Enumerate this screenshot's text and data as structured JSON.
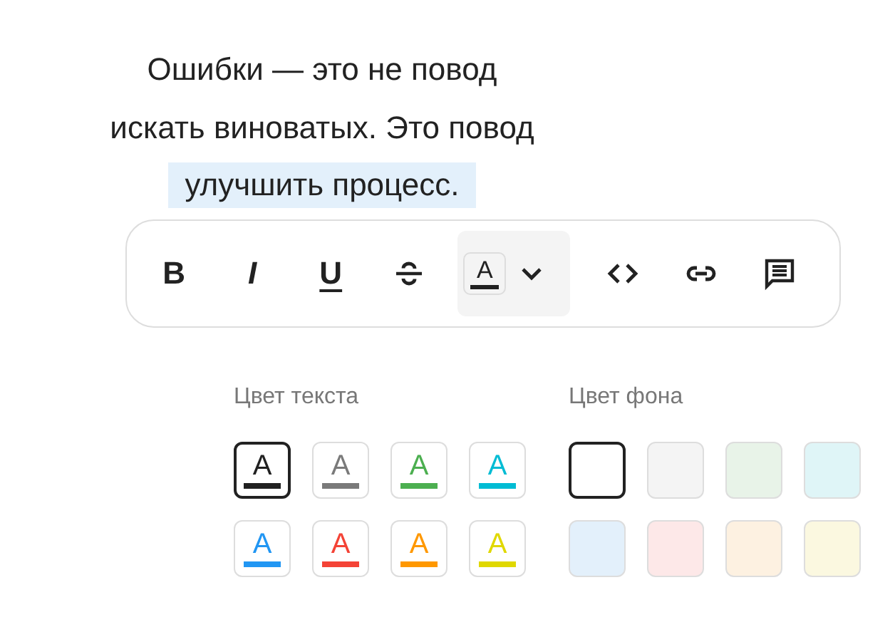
{
  "paragraph": {
    "lines": [
      {
        "text": "Ошибки — это не повод",
        "highlighted": false
      },
      {
        "text": "искать виноватых. Это повод",
        "highlighted": false
      },
      {
        "text": "улучшить процесс.",
        "highlighted": true
      }
    ]
  },
  "toolbar": [
    {
      "kind": "bold",
      "label": "B"
    },
    {
      "kind": "italic",
      "label": "I"
    },
    {
      "kind": "underline",
      "label": "U"
    },
    {
      "kind": "strike"
    },
    {
      "kind": "color",
      "label": "A",
      "color": "#212121",
      "expanded": false
    },
    {
      "kind": "code"
    },
    {
      "kind": "link"
    },
    {
      "kind": "comment"
    }
  ],
  "palette": {
    "text_title": "Цвет текста",
    "background_title": "Цвет фона",
    "text_colors": [
      {
        "letter": "A",
        "color": "#212121",
        "selected": true
      },
      {
        "letter": "A",
        "color": "#7a7a7a",
        "selected": false
      },
      {
        "letter": "A",
        "color": "#4caf50",
        "selected": false
      },
      {
        "letter": "A",
        "color": "#00bcd4",
        "selected": false
      },
      {
        "letter": "A",
        "color": "#2196f3",
        "selected": false
      },
      {
        "letter": "A",
        "color": "#f44336",
        "selected": false
      },
      {
        "letter": "A",
        "color": "#ff9800",
        "selected": false
      },
      {
        "letter": "A",
        "color": "#e0d800",
        "selected": false
      }
    ],
    "background_colors": [
      {
        "color": "#ffffff",
        "selected": true
      },
      {
        "color": "#f4f4f4",
        "selected": false
      },
      {
        "color": "#e8f3e8",
        "selected": false
      },
      {
        "color": "#dff5f7",
        "selected": false
      },
      {
        "color": "#e3f0fb",
        "selected": false
      },
      {
        "color": "#fde8e8",
        "selected": false
      },
      {
        "color": "#fdf1e1",
        "selected": false
      },
      {
        "color": "#fbf8e0",
        "selected": false
      }
    ]
  }
}
